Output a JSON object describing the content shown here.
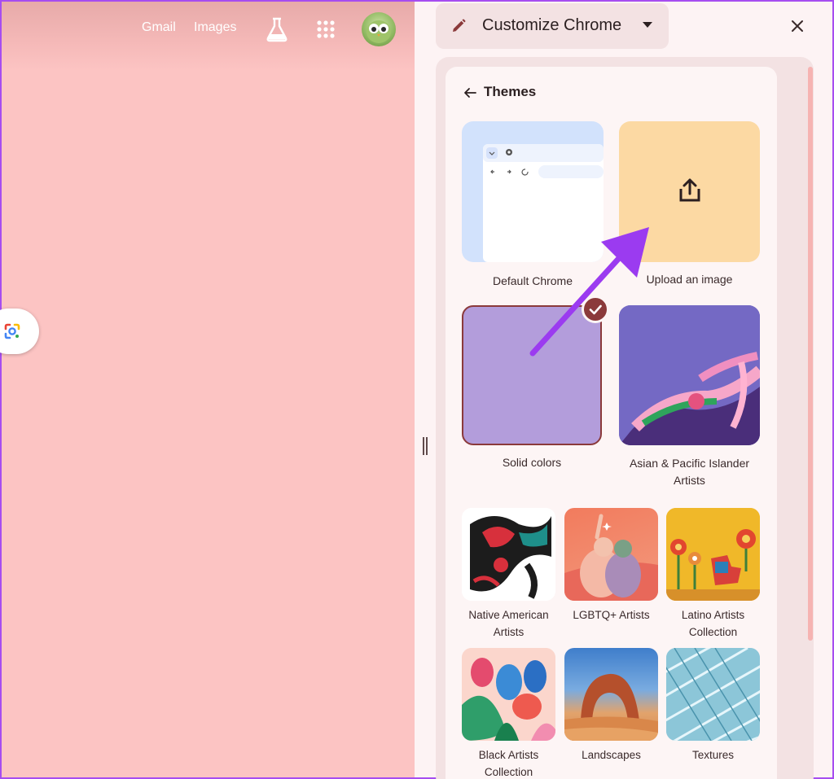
{
  "topbar": {
    "gmail_label": "Gmail",
    "images_label": "Images",
    "labs_icon": "flask-icon",
    "apps_icon": "apps-grid-icon",
    "avatar_icon": "profile-avatar"
  },
  "side_panel": {
    "title": "Customize Chrome",
    "back_heading": "Themes",
    "themes_top": [
      {
        "label": "Default Chrome"
      },
      {
        "label": "Upload an image"
      },
      {
        "label": "Solid colors",
        "selected": true
      },
      {
        "label": "Asian & Pacific Islander Artists"
      }
    ],
    "themes_collections": [
      {
        "label": "Native American Artists"
      },
      {
        "label": "LGBTQ+ Artists"
      },
      {
        "label": "Latino Artists Collection"
      },
      {
        "label": "Black Artists Collection"
      },
      {
        "label": "Landscapes"
      },
      {
        "label": "Textures"
      }
    ]
  },
  "colors": {
    "page_background": "#fcc4c3",
    "panel_background": "#f3e2e3",
    "selected_border": "#8b3a3b",
    "annotation_arrow": "#9b3bf0"
  }
}
